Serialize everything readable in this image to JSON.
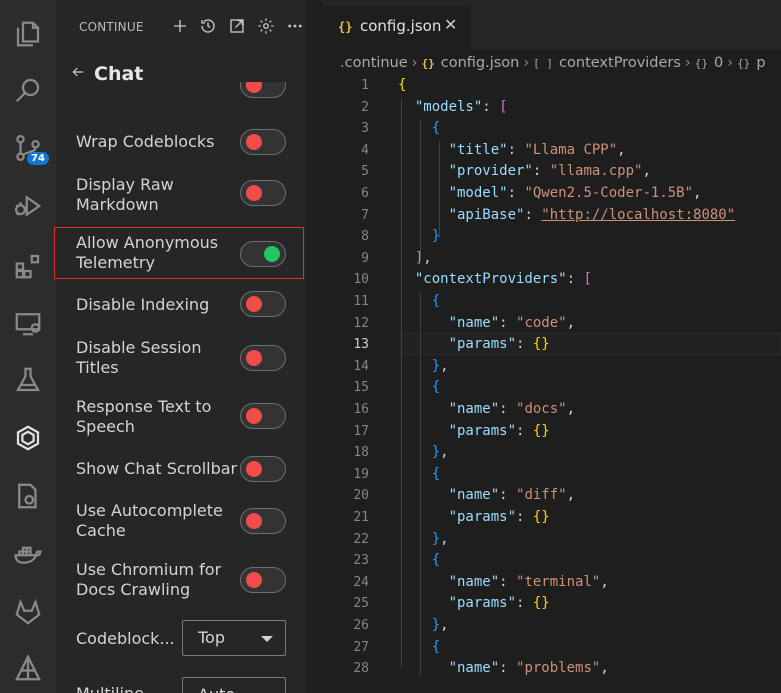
{
  "sidebar": {
    "title": "CONTINUE",
    "header_icons": [
      "plus-icon",
      "history-icon",
      "open-external-icon",
      "gear-icon",
      "more-icon"
    ],
    "chat_title": "Chat",
    "settings": [
      {
        "label": "Wrap Codeblocks",
        "state": "off"
      },
      {
        "label": "Display Raw Markdown",
        "state": "off"
      },
      {
        "label": "Allow Anonymous Telemetry",
        "state": "on"
      },
      {
        "label": "Disable Indexing",
        "state": "off"
      },
      {
        "label": "Disable Session Titles",
        "state": "off"
      },
      {
        "label": "Response Text to Speech",
        "state": "off"
      },
      {
        "label": "Show Chat Scrollbar",
        "state": "off"
      },
      {
        "label": "Use Autocomplete Cache",
        "state": "off"
      },
      {
        "label": "Use Chromium for Docs Crawling",
        "state": "off"
      }
    ],
    "dropdowns": [
      {
        "label": "Codeblock...",
        "value": "Top"
      },
      {
        "label": "Multiline...",
        "value": "Auto"
      }
    ]
  },
  "activity_bar": {
    "icons": [
      "explorer-icon",
      "search-icon",
      "source-control-icon",
      "run-debug-icon",
      "extensions-icon",
      "remote-explorer-icon",
      "testing-icon",
      "continue-icon",
      "gear-file-icon",
      "docker-icon",
      "gitlab-icon",
      "deploy-icon"
    ],
    "source_control_badge": "74"
  },
  "editor": {
    "tab": {
      "icon": "{}",
      "label": "config.json",
      "close": "✕"
    },
    "breadcrumb": [
      ".continue",
      "config.json",
      "contextProviders",
      "0",
      "p"
    ],
    "current_line": 13,
    "lines": [
      {
        "n": "1"
      },
      {
        "n": "2"
      },
      {
        "n": "3"
      },
      {
        "n": "4"
      },
      {
        "n": "5"
      },
      {
        "n": "6"
      },
      {
        "n": "7"
      },
      {
        "n": "8"
      },
      {
        "n": "9"
      },
      {
        "n": "10"
      },
      {
        "n": "11"
      },
      {
        "n": "12"
      },
      {
        "n": "13"
      },
      {
        "n": "14"
      },
      {
        "n": "15"
      },
      {
        "n": "16"
      },
      {
        "n": "17"
      },
      {
        "n": "18"
      },
      {
        "n": "19"
      },
      {
        "n": "20"
      },
      {
        "n": "21"
      },
      {
        "n": "22"
      },
      {
        "n": "23"
      },
      {
        "n": "24"
      },
      {
        "n": "25"
      },
      {
        "n": "26"
      },
      {
        "n": "27"
      },
      {
        "n": "28"
      }
    ],
    "code": {
      "models_key": "\"models\"",
      "title_key": "\"title\"",
      "title_val": "\"Llama CPP\"",
      "provider_key": "\"provider\"",
      "provider_val": "\"llama.cpp\"",
      "model_key": "\"model\"",
      "model_val": "\"Qwen2.5-Coder-1.5B\"",
      "apibase_key": "\"apiBase\"",
      "apibase_val": "\"http://localhost:8080\"",
      "context_key": "\"contextProviders\"",
      "name_key": "\"name\"",
      "params_key": "\"params\"",
      "code_val": "\"code\"",
      "docs_val": "\"docs\"",
      "diff_val": "\"diff\"",
      "terminal_val": "\"terminal\"",
      "problems_val": "\"problems\""
    }
  }
}
